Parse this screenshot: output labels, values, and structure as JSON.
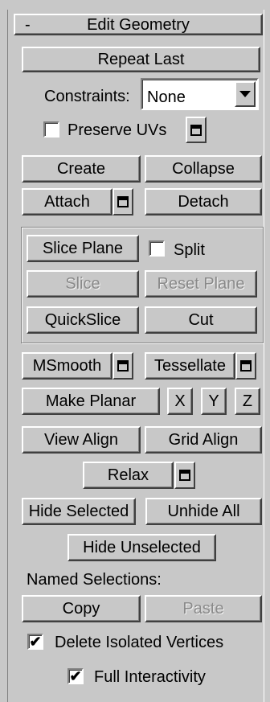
{
  "rollout": {
    "collapse_symbol": "-",
    "title": "Edit Geometry"
  },
  "buttons": {
    "repeat_last": "Repeat Last",
    "create": "Create",
    "collapse": "Collapse",
    "attach": "Attach",
    "detach": "Detach",
    "slice_plane": "Slice Plane",
    "slice": "Slice",
    "reset_plane": "Reset Plane",
    "quickslice": "QuickSlice",
    "cut": "Cut",
    "msmooth": "MSmooth",
    "tessellate": "Tessellate",
    "make_planar": "Make Planar",
    "x": "X",
    "y": "Y",
    "z": "Z",
    "view_align": "View Align",
    "grid_align": "Grid Align",
    "relax": "Relax",
    "hide_selected": "Hide Selected",
    "unhide_all": "Unhide All",
    "hide_unselected": "Hide Unselected",
    "copy": "Copy",
    "paste": "Paste"
  },
  "constraints": {
    "label": "Constraints:",
    "value": "None"
  },
  "checkboxes": {
    "preserve_uvs": {
      "label": "Preserve UVs",
      "checked": false
    },
    "split": {
      "label": "Split",
      "checked": false
    },
    "delete_isolated": {
      "label": "Delete Isolated Vertices",
      "checked": true,
      "mark": "✔"
    },
    "full_interactivity": {
      "label": "Full Interactivity",
      "checked": true,
      "mark": "✔"
    }
  },
  "named_selections_label": "Named Selections:",
  "icons": {
    "settings": "settings-window-icon",
    "dropdown": "triangle-down-icon"
  }
}
